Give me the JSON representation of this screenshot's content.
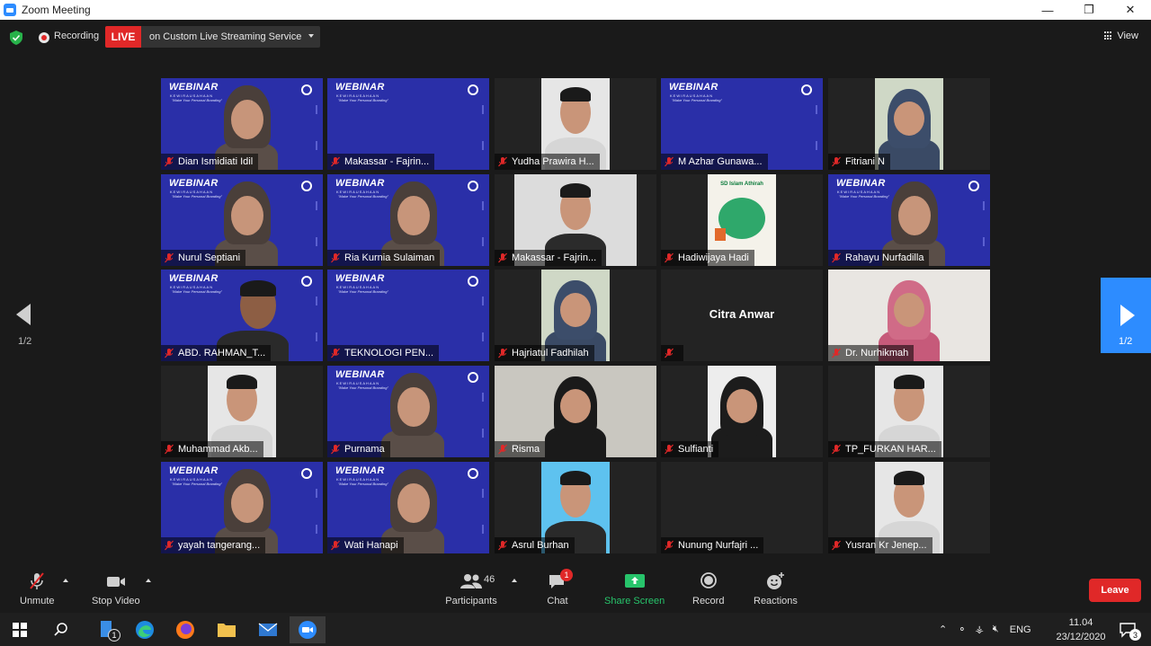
{
  "window": {
    "title": "Zoom Meeting",
    "minimize": "—",
    "maximize": "❐",
    "close": "✕"
  },
  "header": {
    "recording_label": "Recording",
    "live_badge": "LIVE",
    "live_service": "on Custom Live Streaming Service",
    "view_label": "View"
  },
  "webinar_banner": {
    "title": "WEBINAR",
    "subtitle": "KEWIRAUSAHAAN",
    "tagline": "\"Make Your Personal Branding\""
  },
  "participants_grid": [
    {
      "name": "Dian Ismidiati Idil",
      "kind": "webinar-woman"
    },
    {
      "name": "Makassar - Fajrin...",
      "kind": "webinar"
    },
    {
      "name": "Yudha Prawira H...",
      "kind": "camera-man"
    },
    {
      "name": "M Azhar Gunawa...",
      "kind": "webinar"
    },
    {
      "name": "Fitriani N",
      "kind": "camera-window"
    },
    {
      "name": "Nurul Septiani",
      "kind": "webinar-woman"
    },
    {
      "name": "Ria Kurnia Sulaiman",
      "kind": "webinar-woman",
      "active": true
    },
    {
      "name": "Makassar - Fajrin...",
      "kind": "camera-man-wide"
    },
    {
      "name": "Hadiwijaya Hadi",
      "kind": "school-logo"
    },
    {
      "name": "Rahayu Nurfadilla",
      "kind": "webinar-woman"
    },
    {
      "name": "ABD. RAHMAN_T...",
      "kind": "webinar-man"
    },
    {
      "name": "TEKNOLOGI PEN...",
      "kind": "webinar"
    },
    {
      "name": "Hajriatul Fadhilah",
      "kind": "camera-window"
    },
    {
      "name": "Citra Anwar",
      "kind": "no-video"
    },
    {
      "name": "Dr. Nurhikmah",
      "kind": "camera-pink"
    },
    {
      "name": "Muhammad Akb...",
      "kind": "camera-man"
    },
    {
      "name": "Purnama",
      "kind": "webinar-woman"
    },
    {
      "name": "Risma",
      "kind": "camera-woman-wide"
    },
    {
      "name": "Sulfianti",
      "kind": "camera-woman"
    },
    {
      "name": "TP_FURKAN HAR...",
      "kind": "camera-man"
    },
    {
      "name": "yayah tangerang...",
      "kind": "webinar-woman"
    },
    {
      "name": "Wati Hanapi",
      "kind": "webinar-woman"
    },
    {
      "name": "Asrul Burhan",
      "kind": "camera-man-blue"
    },
    {
      "name": "Nunung Nurfajri ...",
      "kind": "no-video-blank"
    },
    {
      "name": "Yusran Kr Jenep...",
      "kind": "camera-man"
    }
  ],
  "school_logo_text": "SD Islam Athirah",
  "page_indicator": {
    "left": "1/2",
    "right": "1/2"
  },
  "toolbar": {
    "unmute": "Unmute",
    "stop_video": "Stop Video",
    "participants_count": "46",
    "participants": "Participants",
    "chat": "Chat",
    "chat_badge": "1",
    "share_screen": "Share Screen",
    "record": "Record",
    "reactions": "Reactions",
    "leave": "Leave"
  },
  "taskbar": {
    "explorer_badge": "1",
    "language": "ENG",
    "time": "11.04",
    "date": "23/12/2020",
    "notification_count": "3"
  },
  "colors": {
    "live": "#e02828",
    "accent": "#2d8cff",
    "share": "#27c46b",
    "webinar_bg": "#2a2fa8",
    "active_speaker": "#e3e84a"
  }
}
